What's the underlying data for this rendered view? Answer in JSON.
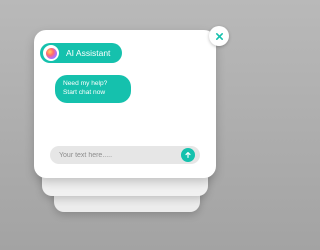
{
  "colors": {
    "background": "#adadad",
    "panel": "#ffffff",
    "accent": "#15c1ad",
    "input_background": "#e6e6e6",
    "placeholder_text": "#8d8d8d"
  },
  "window": {
    "close_icon": "close-icon"
  },
  "header": {
    "avatar_icon": "ai-orb-icon",
    "title": "AI Assistant"
  },
  "messages": [
    {
      "sender": "assistant",
      "lines": [
        "Need my help?",
        "Start chat now"
      ]
    }
  ],
  "composer": {
    "placeholder": "Your text here.....",
    "value": "",
    "send_icon": "send-arrow-icon"
  }
}
